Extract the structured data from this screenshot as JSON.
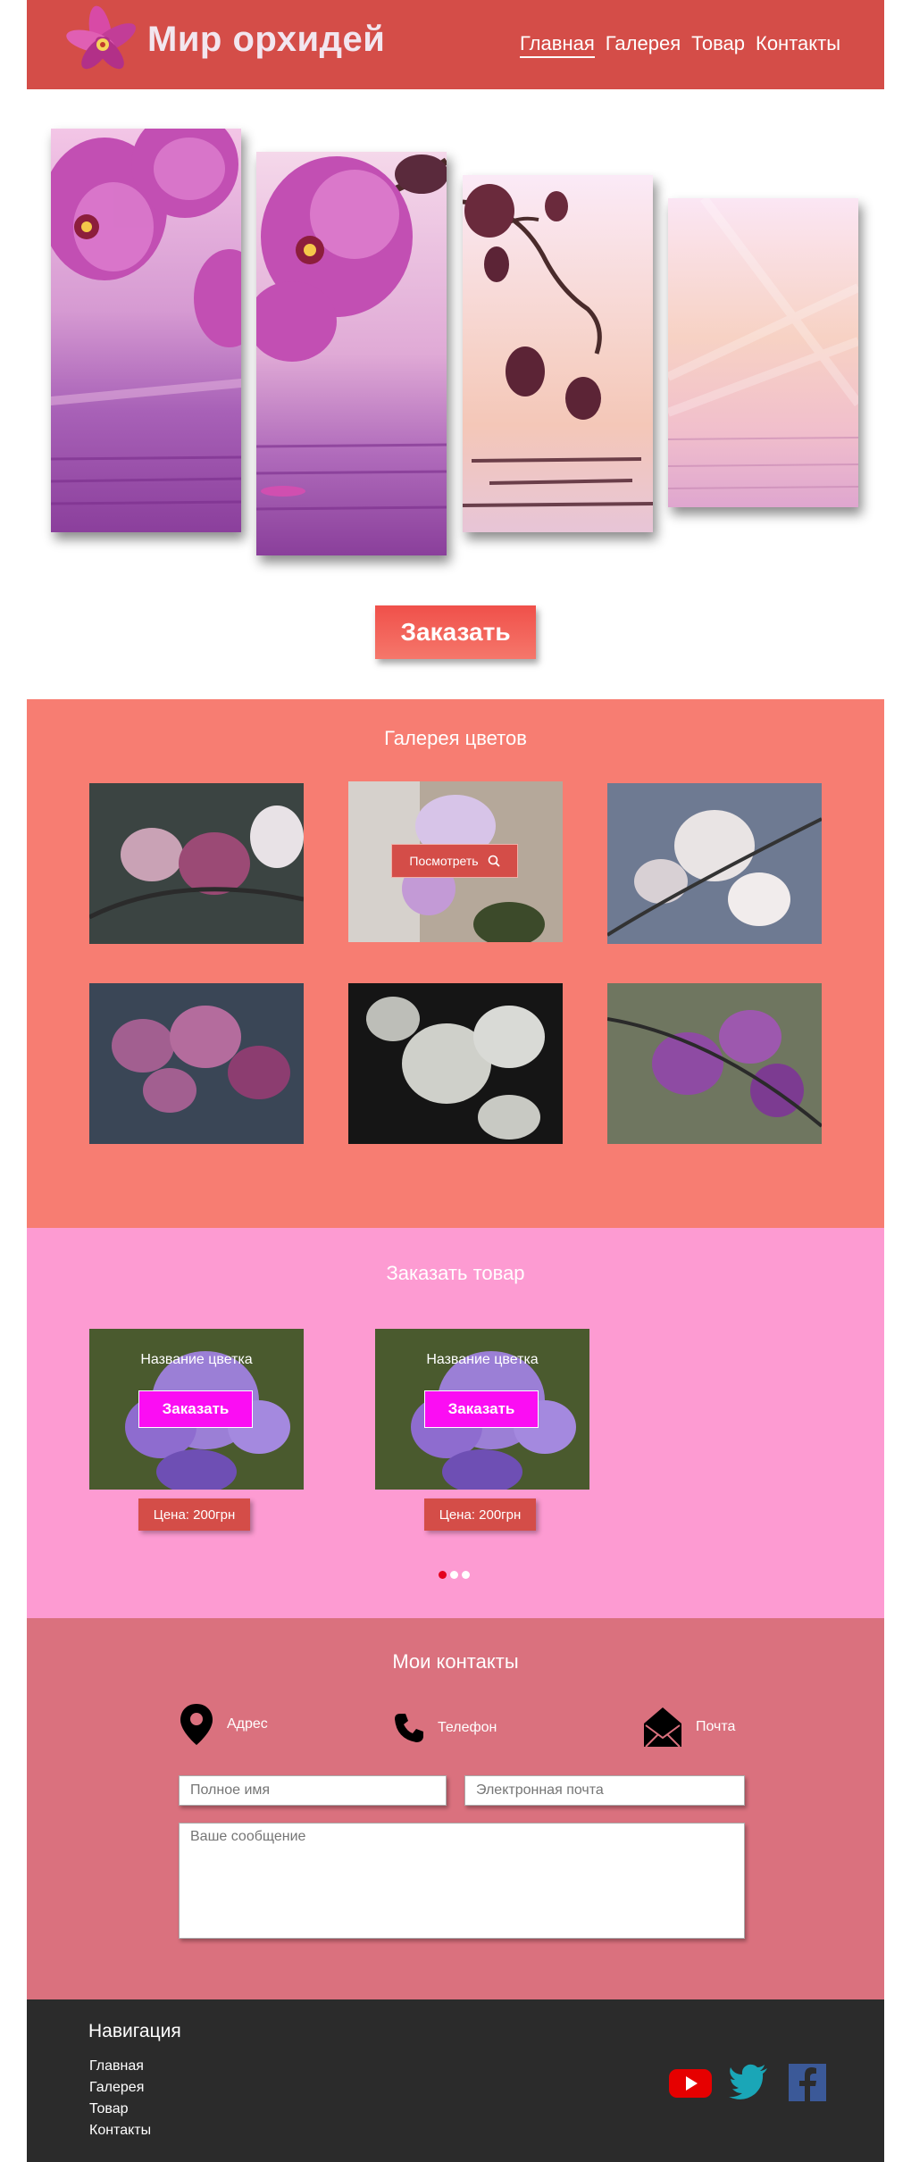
{
  "header": {
    "brand": "Мир орхидей",
    "nav": [
      "Главная",
      "Галерея",
      "Товар",
      "Контакты"
    ]
  },
  "hero": {
    "order_label": "Заказать"
  },
  "gallery": {
    "title": "Галерея цветов",
    "view_label": "Посмотреть"
  },
  "order": {
    "title": "Заказать товар",
    "products": [
      {
        "name": "Название цветка",
        "button": "Заказать",
        "price": "Цена: 200грн"
      },
      {
        "name": "Название цветка",
        "button": "Заказать",
        "price": "Цена: 200грн"
      }
    ]
  },
  "contacts": {
    "title": "Мои контакты",
    "address_label": "Адрес",
    "phone_label": "Телефон",
    "mail_label": "Почта",
    "name_placeholder": "Полное имя",
    "email_placeholder": "Электронная почта",
    "message_placeholder": "Ваше сообщение"
  },
  "footer": {
    "title": "Навигация",
    "links": [
      "Главная",
      "Галерея",
      "Товар",
      "Контакты"
    ]
  },
  "colors": {
    "header": "#d44d48",
    "gallery_bg": "#f77d72",
    "order_bg": "#fd9bd2",
    "contacts_bg": "#da717e",
    "footer_bg": "#2b2b2b",
    "order_button": "#fb0df3"
  }
}
